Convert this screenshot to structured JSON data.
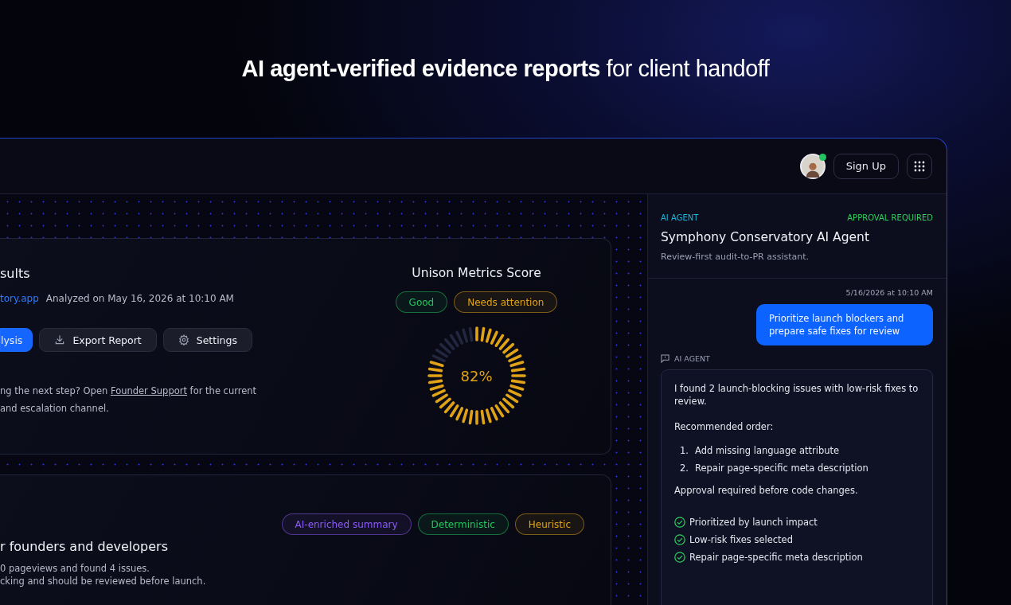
{
  "headline": "**AI agent-verified evidence reports** for client handoff",
  "header": {
    "avatar": {
      "online": true
    },
    "sign_up": "Sign Up"
  },
  "results_card": {
    "title": "sults",
    "site_link": "tory.app",
    "analyzed": "Analyzed on May 16, 2026 at 10:10 AM",
    "buttons": [
      {
        "kind": "primary",
        "label": "lysis"
      },
      {
        "kind": "export",
        "label": "Export Report"
      },
      {
        "kind": "settings",
        "label": "Settings"
      }
    ],
    "support_note": {
      "before": "ng the next step? Open ",
      "link": "Founder Support",
      "after": " for the current and escalation channel."
    },
    "score": {
      "title": "Unison Metrics Score",
      "badges": [
        {
          "label": "Good",
          "color": "#22c55e"
        },
        {
          "label": "Needs attention",
          "color": "#e0a317"
        }
      ],
      "reading": "82%",
      "level": 0.82
    }
  },
  "summary_card": {
    "tags": [
      {
        "label": "AI-enriched summary",
        "color": "#8b5cf6"
      },
      {
        "label": "Deterministic",
        "color": "#22c55e"
      },
      {
        "label": "Heuristic",
        "color": "#e0a317"
      }
    ],
    "title": "r founders and developers",
    "lines": [
      "0 pageviews and found 4 issues.",
      "cking and should be reviewed before launch."
    ]
  },
  "agent_panel": {
    "label": "AI AGENT",
    "status": "APPROVAL REQUIRED",
    "title": "Symphony Conservatory AI Agent",
    "subtitle": "Review-first audit-to-PR assistant.",
    "timestamp": "5/16/2026 at 10:10 AM",
    "user_message": "Prioritize launch blockers and prepare safe fixes for review",
    "agent_label": "AI AGENT",
    "reply": {
      "intro": "I found 2 launch-blocking issues with low-risk fixes to review.",
      "order_heading": "Recommended order:",
      "steps": [
        {
          "number": "1.",
          "text": "Add missing language attribute"
        },
        {
          "number": "2.",
          "text": "Repair page-specific meta description"
        }
      ],
      "approval": "Approval required before code changes.",
      "checks": [
        {
          "text": "Prioritized by launch impact",
          "done": true
        },
        {
          "text": "Low-risk fixes selected",
          "done": true
        },
        {
          "text": "Repair page-specific meta description",
          "done": true
        }
      ]
    }
  }
}
